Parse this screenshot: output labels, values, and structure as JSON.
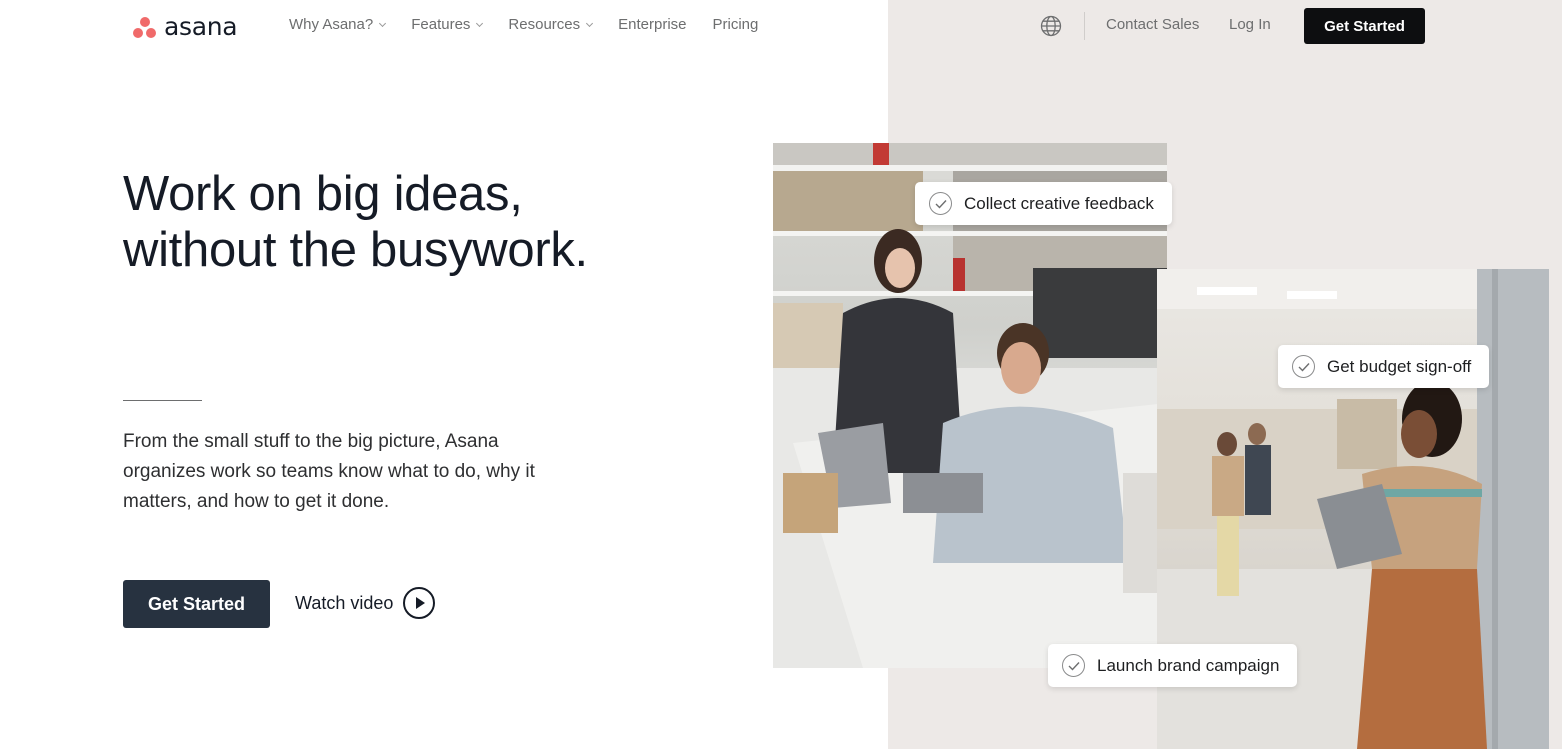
{
  "header": {
    "logo_text": "asana",
    "nav": [
      {
        "label": "Why Asana?",
        "dropdown": true
      },
      {
        "label": "Features",
        "dropdown": true
      },
      {
        "label": "Resources",
        "dropdown": true
      },
      {
        "label": "Enterprise",
        "dropdown": false
      },
      {
        "label": "Pricing",
        "dropdown": false
      }
    ],
    "language_icon": "globe-icon",
    "contact_sales": "Contact Sales",
    "log_in": "Log In",
    "get_started": "Get Started"
  },
  "hero": {
    "title_line1": "Work on big ideas,",
    "title_line2": "without the busywork.",
    "description": "From the small stuff to the big picture, Asana organizes work so teams know what to do, why it matters, and how to get it done.",
    "cta": "Get Started",
    "watch_video": "Watch video"
  },
  "tasks": [
    {
      "label": "Collect creative feedback"
    },
    {
      "label": "Get budget sign-off"
    },
    {
      "label": "Launch brand campaign"
    }
  ],
  "colors": {
    "brand_coral": "#f06a6a",
    "cta_dark": "#273240",
    "header_cta": "#0d0e10",
    "right_panel": "#ede9e7"
  }
}
